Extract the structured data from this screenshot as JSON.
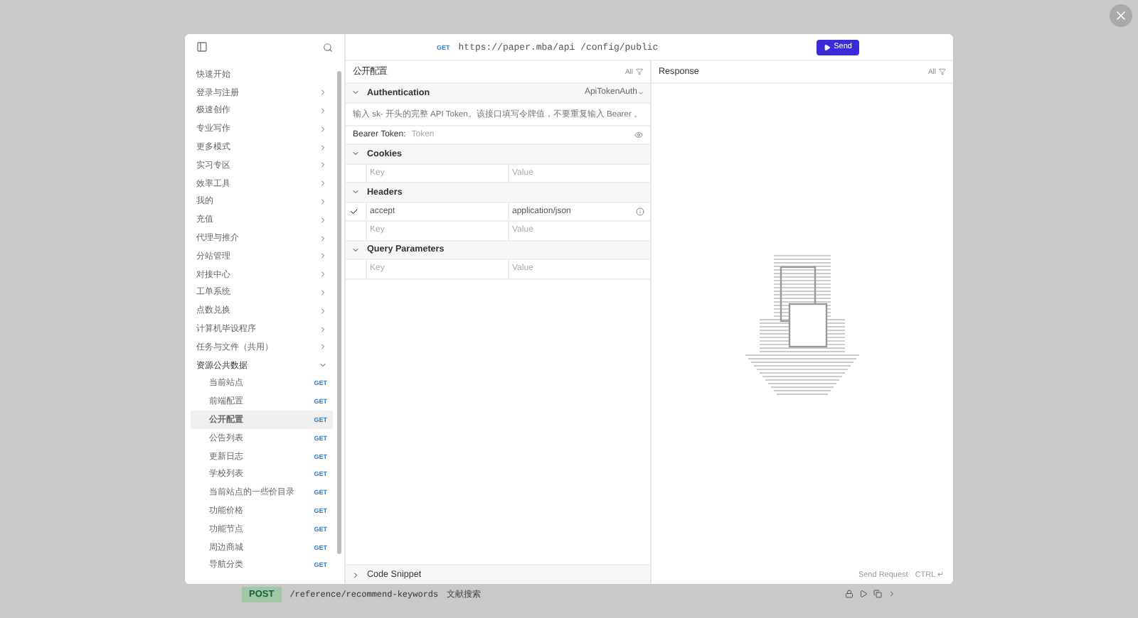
{
  "sidebar": {
    "items": [
      {
        "label": "快速开始"
      },
      {
        "label": "登录与注册",
        "expanded": false
      },
      {
        "label": "极速创作",
        "expanded": false
      },
      {
        "label": "专业写作",
        "expanded": false
      },
      {
        "label": "更多模式",
        "expanded": false
      },
      {
        "label": "实习专区",
        "expanded": false
      },
      {
        "label": "效率工具",
        "expanded": false
      },
      {
        "label": "我的",
        "expanded": false
      },
      {
        "label": "充值",
        "expanded": false
      },
      {
        "label": "代理与推介",
        "expanded": false
      },
      {
        "label": "分站管理",
        "expanded": false
      },
      {
        "label": "对接中心",
        "expanded": false
      },
      {
        "label": "工单系统",
        "expanded": false
      },
      {
        "label": "点数兑换",
        "expanded": false
      },
      {
        "label": "计算机毕设程序",
        "expanded": false
      },
      {
        "label": "任务与文件（共用）",
        "expanded": false
      },
      {
        "label": "资源公共数据",
        "expanded": true,
        "children": [
          {
            "label": "当前站点",
            "method": "GET",
            "selected": false
          },
          {
            "label": "前端配置",
            "method": "GET",
            "selected": false
          },
          {
            "label": "公开配置",
            "method": "GET",
            "selected": true
          },
          {
            "label": "公告列表",
            "method": "GET",
            "selected": false
          },
          {
            "label": "更新日志",
            "method": "GET",
            "selected": false
          },
          {
            "label": "学校列表",
            "method": "GET",
            "selected": false
          },
          {
            "label": "当前站点的一些价目录",
            "method": "GET",
            "selected": false
          },
          {
            "label": "功能价格",
            "method": "GET",
            "selected": false
          },
          {
            "label": "功能节点",
            "method": "GET",
            "selected": false
          },
          {
            "label": "周边商城",
            "method": "GET",
            "selected": false
          },
          {
            "label": "导航分类",
            "method": "GET",
            "selected": false
          }
        ]
      }
    ]
  },
  "request_bar": {
    "method": "GET",
    "url": "https://paper.mba/api /config/public",
    "send": "Send"
  },
  "request": {
    "title": "公开配置",
    "filter": "All",
    "auth": {
      "title": "Authentication",
      "scheme": "ApiTokenAuth",
      "hint": "输入 sk- 开头的完整 API Token。该接口填写令牌值，不要重复输入 Bearer 。",
      "token_label": "Bearer Token:",
      "token_placeholder": "Token"
    },
    "sections": [
      {
        "title": "Cookies",
        "rows": [
          {
            "enabled": false,
            "key": "",
            "value": "",
            "key_placeholder": "Key",
            "value_placeholder": "Value"
          }
        ]
      },
      {
        "title": "Headers",
        "rows": [
          {
            "enabled": true,
            "key": "accept",
            "value": "application/json"
          },
          {
            "enabled": false,
            "key": "",
            "value": "",
            "key_placeholder": "Key",
            "value_placeholder": "Value"
          }
        ]
      },
      {
        "title": "Query Parameters",
        "rows": [
          {
            "enabled": false,
            "key": "",
            "value": "",
            "key_placeholder": "Key",
            "value_placeholder": "Value"
          }
        ]
      }
    ],
    "code_snippet": "Code Snippet"
  },
  "response": {
    "title": "Response",
    "filter": "All",
    "send_hint": "Send Request",
    "shortcut": "CTRL ↵"
  },
  "background_row": {
    "method": "POST",
    "path": "/reference/recommend-keywords",
    "label": "文献搜索"
  }
}
